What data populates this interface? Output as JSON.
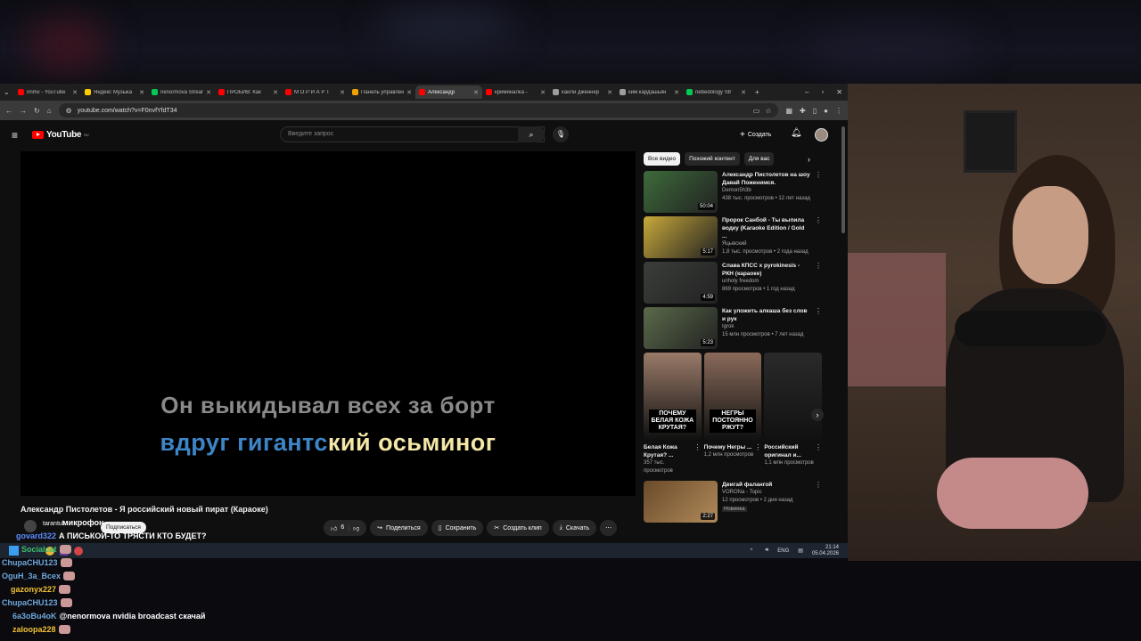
{
  "tabs": [
    {
      "label": "nnmv - YouTube",
      "color": "#ff0000",
      "active": false
    },
    {
      "label": "Яндекс Музыка",
      "color": "#ffcc00",
      "active": false
    },
    {
      "label": "nenormova Streams",
      "color": "#00c853",
      "active": false
    },
    {
      "label": "ПРОБИВ: Как",
      "color": "#ff0000",
      "active": false
    },
    {
      "label": "М О Р И А Р Т",
      "color": "#ff0000",
      "active": false
    },
    {
      "label": "Панель управления",
      "color": "#f0a000",
      "active": false
    },
    {
      "label": "Александр",
      "color": "#ff0000",
      "active": true
    },
    {
      "label": "криминалка -",
      "color": "#ff0000",
      "active": false
    },
    {
      "label": "кайли дженнер",
      "color": "#9e9e9e",
      "active": false
    },
    {
      "label": "ким кардашьян",
      "color": "#9e9e9e",
      "active": false
    },
    {
      "label": "nebedology Str",
      "color": "#00c853",
      "active": false
    }
  ],
  "address": {
    "url": "youtube.com/watch?v=F0nvfYfdT34"
  },
  "header": {
    "logo_text": "YouTube",
    "logo_region": "RU",
    "search_placeholder": "Введите запрос",
    "create_label": "Создать"
  },
  "player": {
    "lyric_line1": "Он выкидывал всех за борт",
    "lyric_line2_sung": "вдруг гигантс",
    "lyric_line2_rest": "кий осьминог"
  },
  "video": {
    "title": "Александр Пистолетов - Я российский новый пират (Караоке)",
    "channel": "tarantul",
    "subscribe_label": "Подписаться",
    "likes": "6",
    "share_label": "Поделиться",
    "save_label": "Сохранить",
    "clip_label": "Создать клип",
    "download_label": "Скачать"
  },
  "chips": [
    {
      "label": "Все видео",
      "active": true
    },
    {
      "label": "Похожий контент",
      "active": false
    },
    {
      "label": "Для вас",
      "active": false
    }
  ],
  "recommendations": [
    {
      "title": "Александр Пистолетов на шоу Давай Поженимся.",
      "channel": "Demon5h3b",
      "meta": "438 тыс. просмотров • 12 лет назад",
      "duration": "50:04",
      "thumb": "#3d6b3a"
    },
    {
      "title": "Пророк Санбой - Ты выпила водку (Karaoke Edition / Gold ...",
      "channel": "Яцывский",
      "meta": "1,8 тыс. просмотров • 2 года назад",
      "duration": "5:17",
      "thumb": "#c8a93a"
    },
    {
      "title": "Слава КПСС x pyrokinesis - РКН (караоке)",
      "channel": "unholy freedom",
      "meta": "869 просмотров • 1 год назад",
      "duration": "4:59",
      "thumb": "#3a3e3a"
    },
    {
      "title": "Как уложить алкаша без слов и рук",
      "channel": "Igrok",
      "meta": "15 млн просмотров • 7 лет назад",
      "duration": "5:23",
      "thumb": "#5a6a4a"
    }
  ],
  "shorts": [
    {
      "title": "Белая Кожа Крутая? ...",
      "meta": "357 тыс. просмотров",
      "caption": "ПОЧЕМУ БЕЛАЯ КОЖА КРУТАЯ?"
    },
    {
      "title": "Почему Негры ...",
      "meta": "1,2 млн просмотров",
      "caption": "НЕГРЫ ПОСТОЯННО РЖУТ?"
    },
    {
      "title": "Российский оригинал и...",
      "meta": "1,1 млн просмотров",
      "caption": ""
    }
  ],
  "last_rec": {
    "title": "Двигай фалангой",
    "channel": "VORONa - Topic",
    "meta": "12 просмотров • 2 дня назад",
    "badge": "Новинка",
    "duration": "2:27"
  },
  "taskbar": {
    "lang": "ENG",
    "time": "21:14",
    "date": "05.04.2026"
  },
  "chat": [
    {
      "user": "govard322",
      "user_color": "#5b8cff",
      "text": "А ПИСЬКОЙ-ТО ТРЯСТИ КТО БУДЕТ?"
    },
    {
      "user": "Socialcat",
      "user_color": "#3cbf6b",
      "text": ""
    },
    {
      "user": "ChupaCHU123",
      "user_color": "#6fa8dc",
      "text": ""
    },
    {
      "user": "OguH_3a_Bcex",
      "user_color": "#6fa8dc",
      "text": ""
    },
    {
      "user": "gazonyx227",
      "user_color": "#f1c232",
      "text": ""
    },
    {
      "user": "ChupaCHU123",
      "user_color": "#6fa8dc",
      "text": ""
    },
    {
      "user": "6a3oBu4oK",
      "user_color": "#6fa8dc",
      "text": "@nenormova nvidia broadcast скачай"
    },
    {
      "user": "zaloopa228",
      "user_color": "#f1c232",
      "text": ""
    }
  ],
  "overlay_text": "микрофон"
}
